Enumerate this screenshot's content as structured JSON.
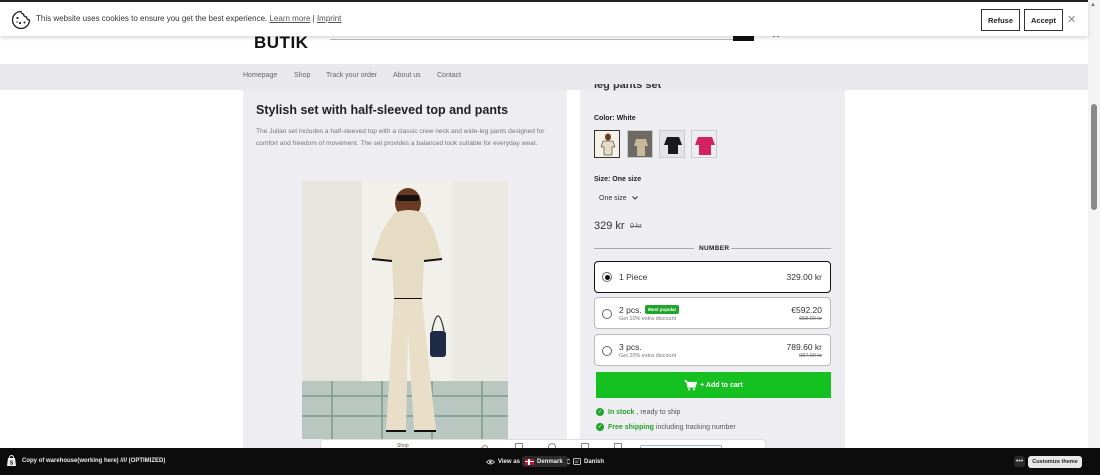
{
  "cookie_banner": {
    "text": "This website uses cookies to ensure you get the best experience.",
    "learn_more": "Learn more",
    "separator": "|",
    "imprint": "Imprint",
    "refuse_label": "Refuse",
    "accept_label": "Accept",
    "close_glyph": "✕"
  },
  "header": {
    "logo": "BUTIK"
  },
  "nav": {
    "items": [
      "Homepage",
      "Shop",
      "Track your order",
      "About us",
      "Contact"
    ]
  },
  "description": {
    "title": "Stylish set with half-sleeved top and pants",
    "text": "The Julian set includes a half-sleeved top with a classic crew neck and wide-leg pants designed for comfort and freedom of movement. The set provides a balanced look suitable for everyday wear."
  },
  "product": {
    "cut_title": "leg pants set",
    "color_label": "Color:",
    "color_value": "White",
    "swatches": [
      "white",
      "beige",
      "black",
      "pink"
    ],
    "size_label": "Size:",
    "size_value": "One size",
    "size_select": "One size",
    "price": "329 kr",
    "old_price": "0 kr",
    "number_label": "NUMBER",
    "options": [
      {
        "name": "1 Piece",
        "sub": "",
        "price": "329.00 kr",
        "old": "",
        "selected": true
      },
      {
        "name": "2 pcs.",
        "badge": "Most popular",
        "sub": "Get 10% extra discount",
        "price": "€592.20",
        "old": "658.00 kr",
        "selected": false
      },
      {
        "name": "3 pcs.",
        "sub": "Get 20% extra discount",
        "price": "789.60 kr",
        "old": "987.00 kr",
        "selected": false
      }
    ],
    "add_to_cart": "+ Add to cart",
    "stock_bold": "In stock",
    "stock_rest": ", ready to ship",
    "shipping_bold": "Free shipping",
    "shipping_rest": "including tracking number"
  },
  "float_toolbar": {
    "shop": "Shop"
  },
  "admin_bar": {
    "title": "Copy of warehouse(working here) //// (OPTIMIZED)",
    "view_as": "View as",
    "country": "Denmark",
    "language": "Danish",
    "customize": "Customize theme"
  },
  "colors": {
    "green": "#15c021",
    "panel": "#eeedf1",
    "nav": "#e9e8ec"
  }
}
